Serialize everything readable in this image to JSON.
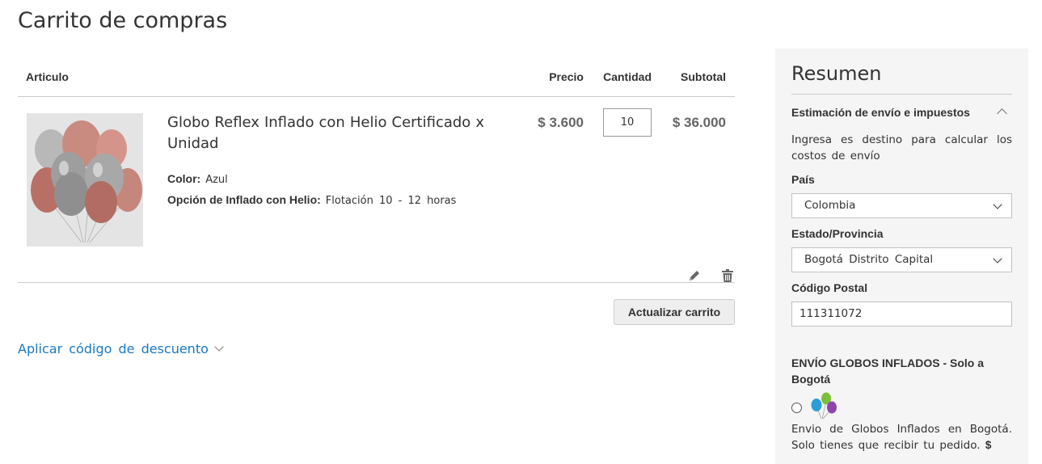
{
  "page": {
    "title": "Carrito de compras"
  },
  "cart": {
    "headers": {
      "item": "Articulo",
      "price": "Precio",
      "qty": "Cantidad",
      "subtotal": "Subtotal"
    },
    "items": [
      {
        "name": "Globo Reflex Inflado con Helio Certificado x Unidad",
        "options": [
          {
            "label": "Color:",
            "value": "Azul"
          },
          {
            "label": "Opción de Inflado con Helio:",
            "value": "Flotación 10 - 12 horas"
          }
        ],
        "price": "$ 3.600",
        "qty": "10",
        "subtotal": "$ 36.000",
        "thumbnail_icon": "balloon-bouquet-image"
      }
    ],
    "update_label": "Actualizar carrito"
  },
  "discount": {
    "label": "Aplicar código de descuento"
  },
  "summary": {
    "title": "Resumen",
    "estimate_title": "Estimación de envío e impuestos",
    "estimate_desc": "Ingresa es destino para calcular los costos de envío",
    "country_label": "País",
    "country_value": "Colombia",
    "state_label": "Estado/Provincia",
    "state_value": "Bogotá Distrito Capital",
    "postal_label": "Código Postal",
    "postal_value": "111311072",
    "shipping_title": "ENVÍO GLOBOS INFLADOS - Solo a Bogotá",
    "shipping_desc": "Envio de Globos Inflados en Bogotá. Solo tienes que recibir tu pedido.",
    "shipping_price_prefix": "$"
  },
  "colors": {
    "link": "#1979c3",
    "summary_bg": "#f5f5f5",
    "button_bg": "#eeeeee"
  }
}
